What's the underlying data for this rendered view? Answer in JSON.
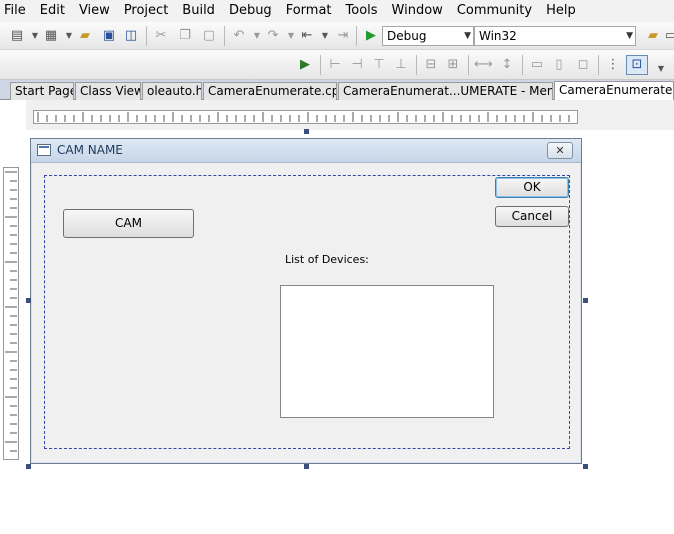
{
  "menu": [
    "File",
    "Edit",
    "View",
    "Project",
    "Build",
    "Debug",
    "Format",
    "Tools",
    "Window",
    "Community",
    "Help"
  ],
  "toolbar": {
    "config_combo": "Debug",
    "platform_combo": "Win32"
  },
  "tabs": [
    {
      "label": "Start Page",
      "active": false
    },
    {
      "label": "Class View",
      "active": false
    },
    {
      "label": "oleauto.h",
      "active": false
    },
    {
      "label": "CameraEnumerate.cpp",
      "active": false
    },
    {
      "label": "CameraEnumerat...UMERATE - Menu)",
      "active": false
    },
    {
      "label": "CameraEnumerate...",
      "active": true
    }
  ],
  "dialog": {
    "title": "CAM NAME",
    "close_glyph": "✕",
    "ok_label": "OK",
    "cancel_label": "Cancel",
    "cam_label": "CAM",
    "list_label": "List of Devices:"
  },
  "colors": {
    "accent": "#3c7fb1",
    "selection_dash": "#3344aa"
  }
}
